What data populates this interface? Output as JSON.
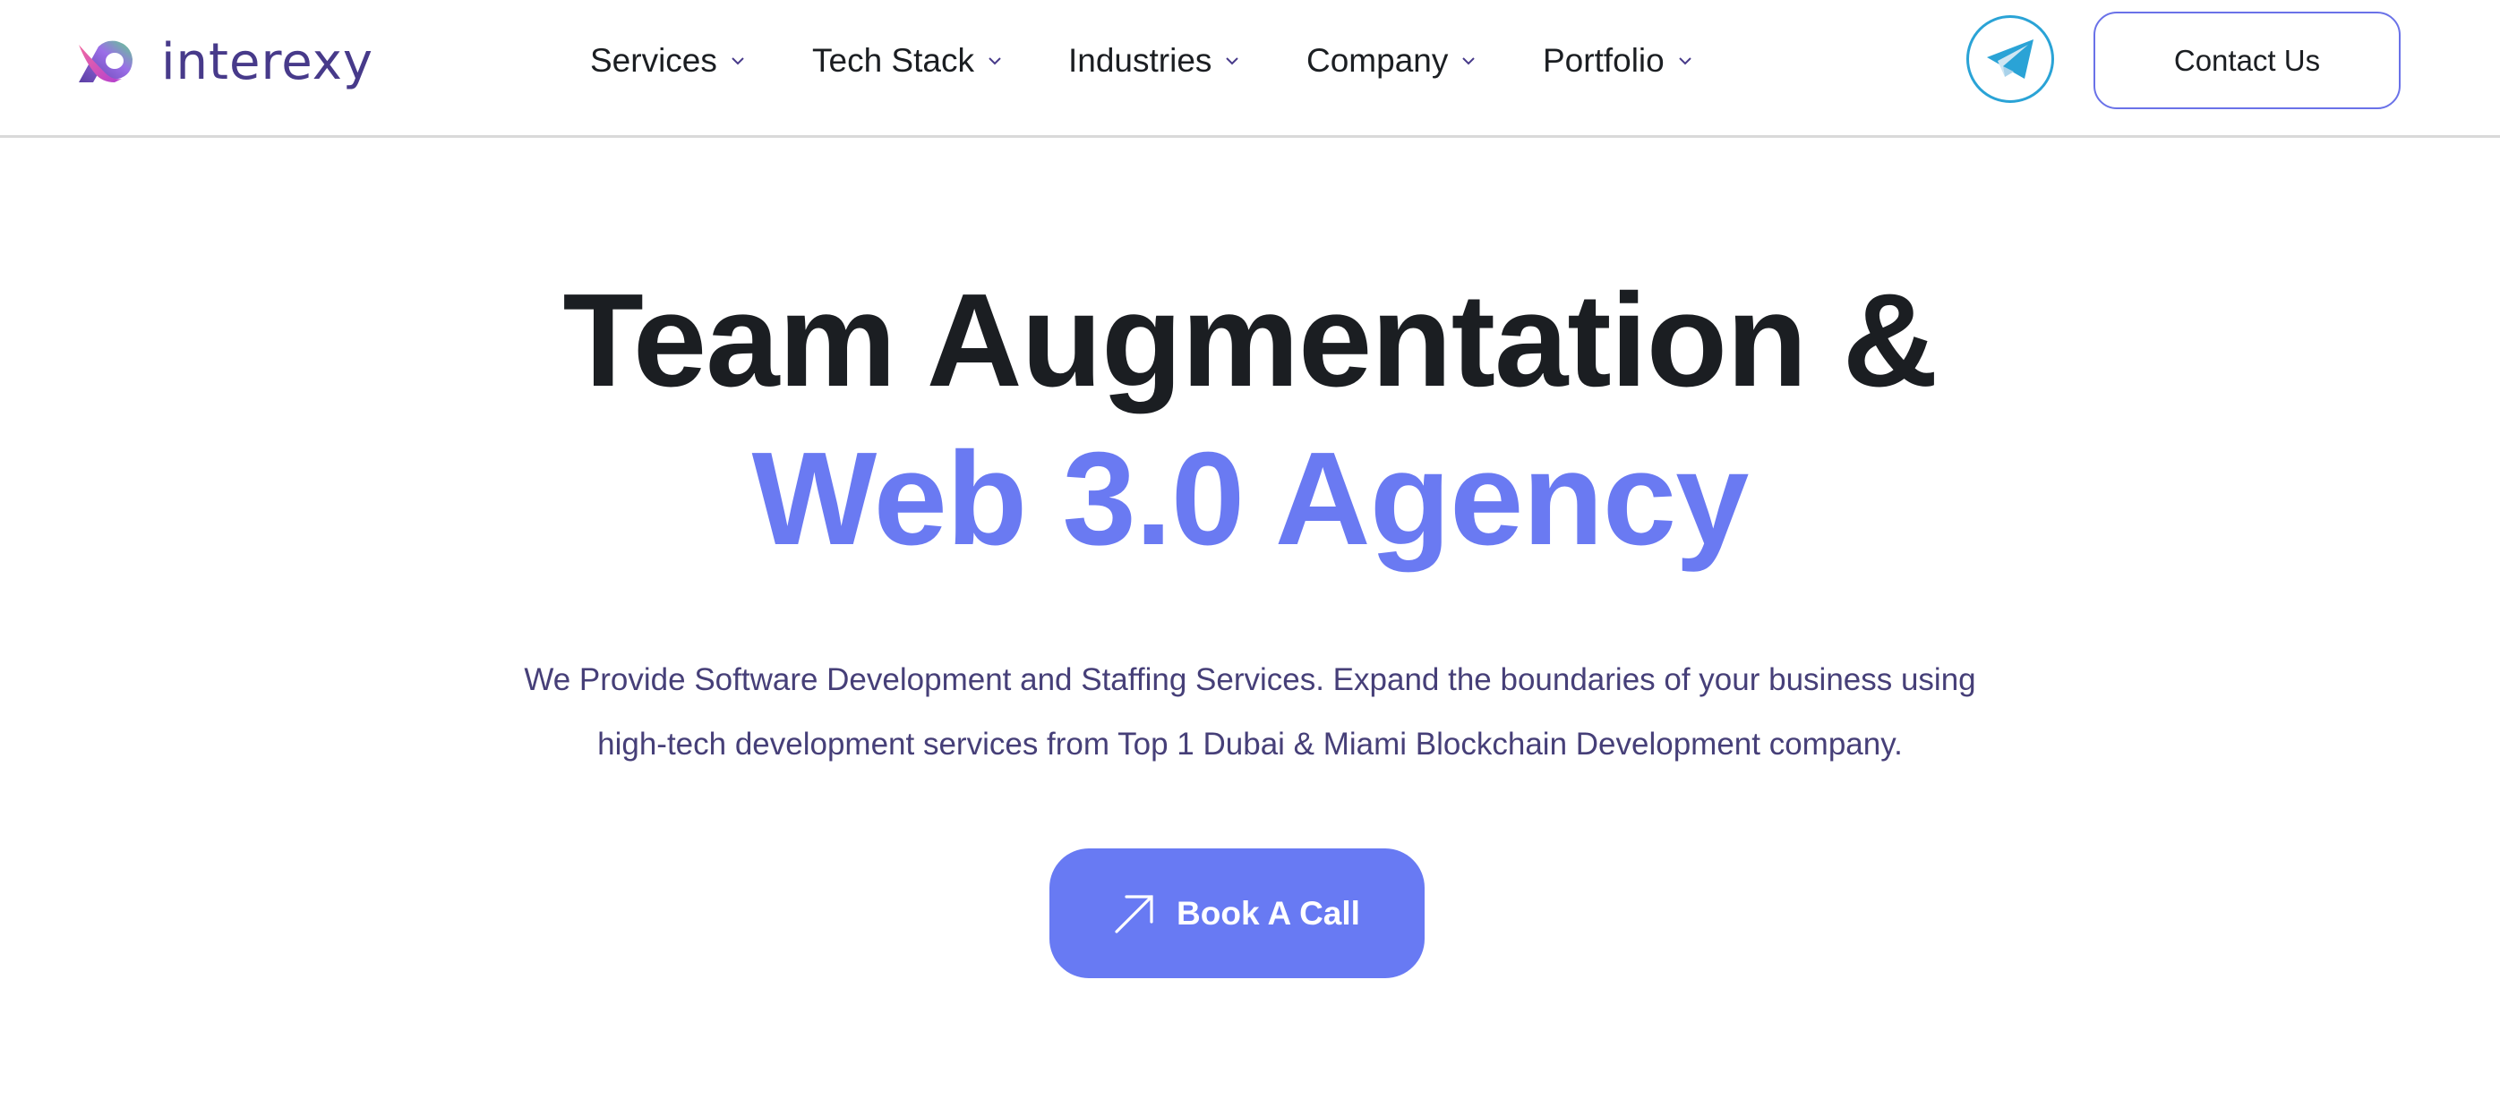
{
  "brand": {
    "name": "interexy",
    "logo_icon": "interexy-logo-icon",
    "text_color": "#473a8a"
  },
  "nav": {
    "items": [
      {
        "label": "Services",
        "icon": "chevron-down-icon"
      },
      {
        "label": "Tech Stack",
        "icon": "chevron-down-icon"
      },
      {
        "label": "Industries",
        "icon": "chevron-down-icon"
      },
      {
        "label": "Company",
        "icon": "chevron-down-icon"
      },
      {
        "label": "Portfolio",
        "icon": "chevron-down-icon"
      }
    ]
  },
  "header_actions": {
    "telegram_icon": "telegram-icon",
    "telegram_color": "#2aa3d6",
    "contact_label": "Contact Us",
    "contact_border_color": "#6a72e8"
  },
  "hero": {
    "title_line1": "Team Augmentation &",
    "title_line2": "Web 3.0 Agency",
    "title_line2_color": "#6a7af2",
    "description_line1": "We Provide Software Development and Staffing Services. Expand the boundaries of your business using",
    "description_line2": "high-tech development services from Top 1 Dubai & Miami Blockchain Development company.",
    "cta_label": "Book A Call",
    "cta_icon": "arrow-up-right-icon",
    "cta_color": "#687af3"
  }
}
